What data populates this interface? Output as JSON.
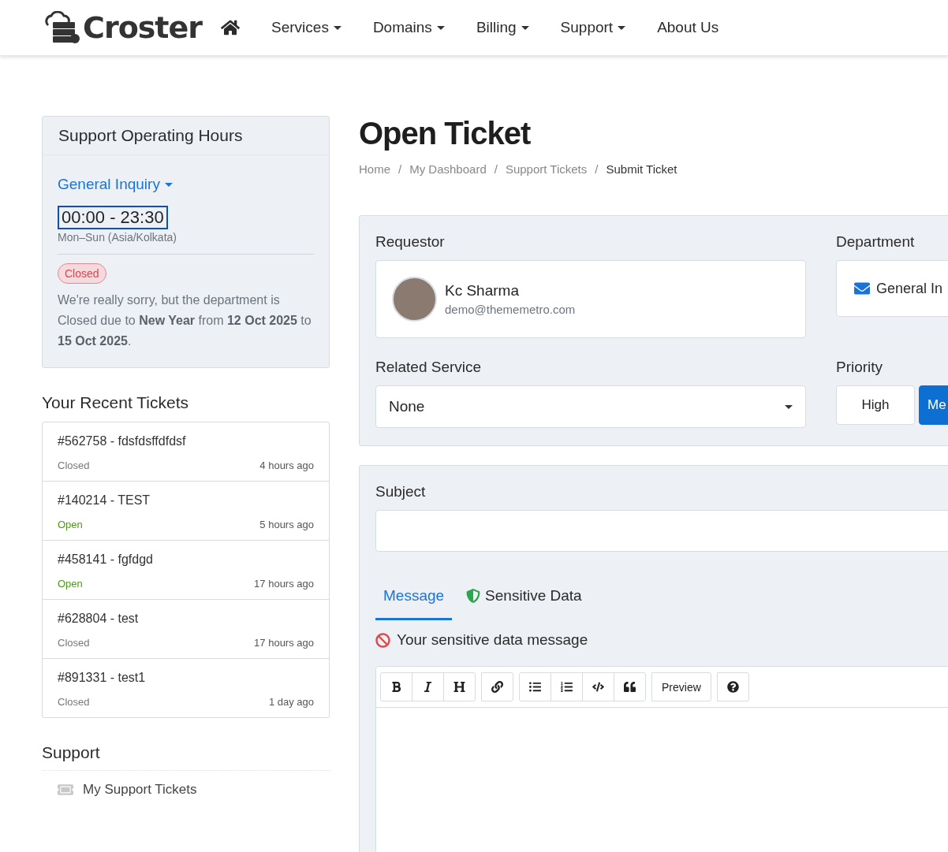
{
  "brand": {
    "name": "Croster"
  },
  "nav": [
    {
      "label": "Services",
      "dropdown": true
    },
    {
      "label": "Domains",
      "dropdown": true
    },
    {
      "label": "Billing",
      "dropdown": true
    },
    {
      "label": "Support",
      "dropdown": true
    },
    {
      "label": "About Us",
      "dropdown": false
    }
  ],
  "hours": {
    "title": "Support Operating Hours",
    "department": "General Inquiry",
    "time": "00:00 - 23:30",
    "days": "Mon–Sun (Asia/Kolkata)",
    "badge": "Closed",
    "notice": "We're really sorry, but the department is Closed due to **New Year** from **12 Oct 2025** to **15 Oct 2025**."
  },
  "recent": {
    "title": "Your Recent Tickets",
    "tickets": [
      {
        "title": "#562758 - fdsfdsffdfdsf",
        "status": "Closed",
        "kind": "closed",
        "time": "4 hours ago"
      },
      {
        "title": "#140214 - TEST",
        "status": "Open",
        "kind": "open",
        "time": "5 hours ago"
      },
      {
        "title": "#458141 - fgfdgd",
        "status": "Open",
        "kind": "open",
        "time": "17 hours ago"
      },
      {
        "title": "#628804 - test",
        "status": "Closed",
        "kind": "closed",
        "time": "17 hours ago"
      },
      {
        "title": "#891331 - test1",
        "status": "Closed",
        "kind": "closed",
        "time": "1 day ago"
      }
    ]
  },
  "support": {
    "title": "Support",
    "items": [
      {
        "label": "My Support Tickets"
      }
    ]
  },
  "page": {
    "title": "Open Ticket",
    "separator": "/",
    "breadcrumb": [
      {
        "label": "Home",
        "current": false
      },
      {
        "label": "My Dashboard",
        "current": false
      },
      {
        "label": "Support Tickets",
        "current": false
      },
      {
        "label": "Submit Ticket",
        "current": true
      }
    ]
  },
  "form": {
    "requestor_label": "Requestor",
    "requestor": {
      "name": "Kc Sharma",
      "email": "demo@thememetro.com"
    },
    "department_label": "Department",
    "department": "General In",
    "service_label": "Related Service",
    "service": "None",
    "priority_label": "Priority",
    "priorities": [
      {
        "label": "High",
        "selected": false
      },
      {
        "label": "Me",
        "selected": true
      }
    ],
    "subject_label": "Subject",
    "tabs": [
      {
        "label": "Message",
        "kind": "plain",
        "selected": true
      },
      {
        "label": "Sensitive Data",
        "kind": "shield",
        "selected": false
      }
    ],
    "sensitive_note": "Your sensitive data message",
    "toolbar": [
      [
        {
          "kind": "bold"
        },
        {
          "kind": "italic"
        },
        {
          "kind": "heading"
        }
      ],
      [
        {
          "kind": "link"
        }
      ],
      [
        {
          "kind": "bullets"
        },
        {
          "kind": "numbers"
        },
        {
          "kind": "code"
        },
        {
          "kind": "quote"
        }
      ],
      [
        {
          "kind": "text",
          "label": "Preview"
        }
      ],
      [
        {
          "kind": "help"
        }
      ]
    ]
  }
}
